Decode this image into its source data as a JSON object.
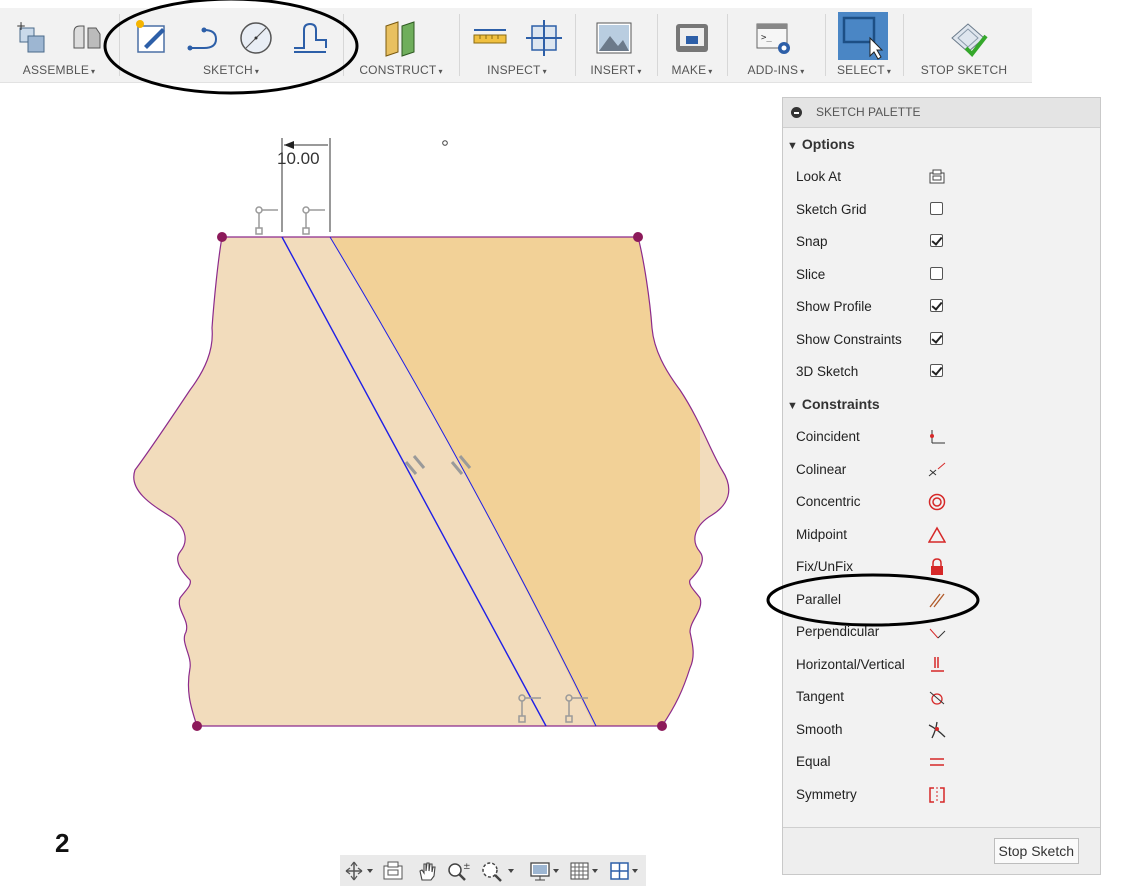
{
  "toolbar": {
    "groups": [
      {
        "label": "ASSEMBLE",
        "icons": [
          "new-component-icon",
          "joint-icon"
        ]
      },
      {
        "label": "SKETCH",
        "icons": [
          "create-sketch-icon",
          "spline-icon",
          "circle-icon",
          "offset-icon"
        ]
      },
      {
        "label": "CONSTRUCT",
        "icons": [
          "offset-plane-icon"
        ]
      },
      {
        "label": "INSPECT",
        "icons": [
          "measure-icon",
          "section-analysis-icon"
        ]
      },
      {
        "label": "INSERT",
        "icons": [
          "insert-image-icon"
        ]
      },
      {
        "label": "MAKE",
        "icons": [
          "3d-print-icon"
        ]
      },
      {
        "label": "ADD-INS",
        "icons": [
          "scripts-icon"
        ]
      },
      {
        "label": "SELECT",
        "icons": [
          "select-icon"
        ]
      },
      {
        "label": "STOP SKETCH",
        "icons": [
          "stop-sketch-icon"
        ]
      }
    ],
    "caret": "▾"
  },
  "canvas": {
    "dimension_value": "10.00",
    "fill_light": "#f2dcbc",
    "fill_dark": "#f2d197",
    "outline_color": "#8c2b8c",
    "line_color": "#1f1fe6"
  },
  "palette": {
    "title": "SKETCH PALETTE",
    "options_header": "Options",
    "options": [
      {
        "label": "Look At",
        "control": "look-at-icon"
      },
      {
        "label": "Sketch Grid",
        "checked": false
      },
      {
        "label": "Snap",
        "checked": true
      },
      {
        "label": "Slice",
        "checked": false
      },
      {
        "label": "Show Profile",
        "checked": true
      },
      {
        "label": "Show Constraints",
        "checked": true
      },
      {
        "label": "3D Sketch",
        "checked": true
      }
    ],
    "constraints_header": "Constraints",
    "constraints": [
      {
        "label": "Coincident",
        "icon": "coincident-icon"
      },
      {
        "label": "Colinear",
        "icon": "colinear-icon"
      },
      {
        "label": "Concentric",
        "icon": "concentric-icon"
      },
      {
        "label": "Midpoint",
        "icon": "midpoint-icon"
      },
      {
        "label": "Fix/UnFix",
        "icon": "fix-icon"
      },
      {
        "label": "Parallel",
        "icon": "parallel-icon"
      },
      {
        "label": "Perpendicular",
        "icon": "perpendicular-icon"
      },
      {
        "label": "Horizontal/Vertical",
        "icon": "horizontal-vertical-icon"
      },
      {
        "label": "Tangent",
        "icon": "tangent-icon"
      },
      {
        "label": "Smooth",
        "icon": "smooth-icon"
      },
      {
        "label": "Equal",
        "icon": "equal-icon"
      },
      {
        "label": "Symmetry",
        "icon": "symmetry-icon"
      }
    ],
    "stop_button": "Stop Sketch"
  },
  "step_number": "2"
}
